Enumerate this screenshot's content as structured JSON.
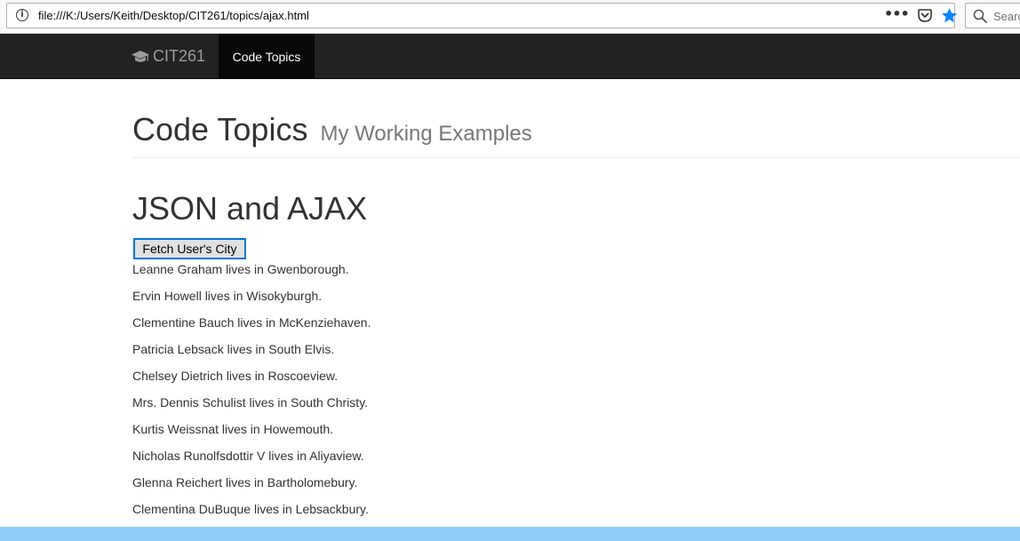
{
  "browser": {
    "url": "file:///K:/Users/Keith/Desktop/CIT261/topics/ajax.html",
    "search_placeholder": "Search",
    "page_actions": "•••"
  },
  "navbar": {
    "brand": "CIT261",
    "active_item": "Code Topics"
  },
  "header": {
    "title": "Code Topics",
    "subtitle": "My Working Examples"
  },
  "section": {
    "title": "JSON and AJAX",
    "button_label": "Fetch User's City"
  },
  "results": [
    "Leanne Graham lives in Gwenborough.",
    "Ervin Howell lives in Wisokyburgh.",
    "Clementine Bauch lives in McKenziehaven.",
    "Patricia Lebsack lives in South Elvis.",
    "Chelsey Dietrich lives in Roscoeview.",
    "Mrs. Dennis Schulist lives in South Christy.",
    "Kurtis Weissnat lives in Howemouth.",
    "Nicholas Runolfsdottir V lives in Aliyaview.",
    "Glenna Reichert lives in Bartholomebury.",
    "Clementina DuBuque lives in Lebsackbury."
  ],
  "colors": {
    "navbar_bg": "#222222",
    "active_nav_bg": "#080808",
    "button_focus_border": "#0078d7",
    "bookmark_star": "#0a84ff",
    "bottom_strip": "#8ecdf7"
  },
  "icons": {
    "site_info": "info-icon",
    "page_actions": "more-icon",
    "pocket": "pocket-icon",
    "bookmark": "star-icon",
    "search": "search-icon",
    "brand": "graduation-cap-icon"
  }
}
